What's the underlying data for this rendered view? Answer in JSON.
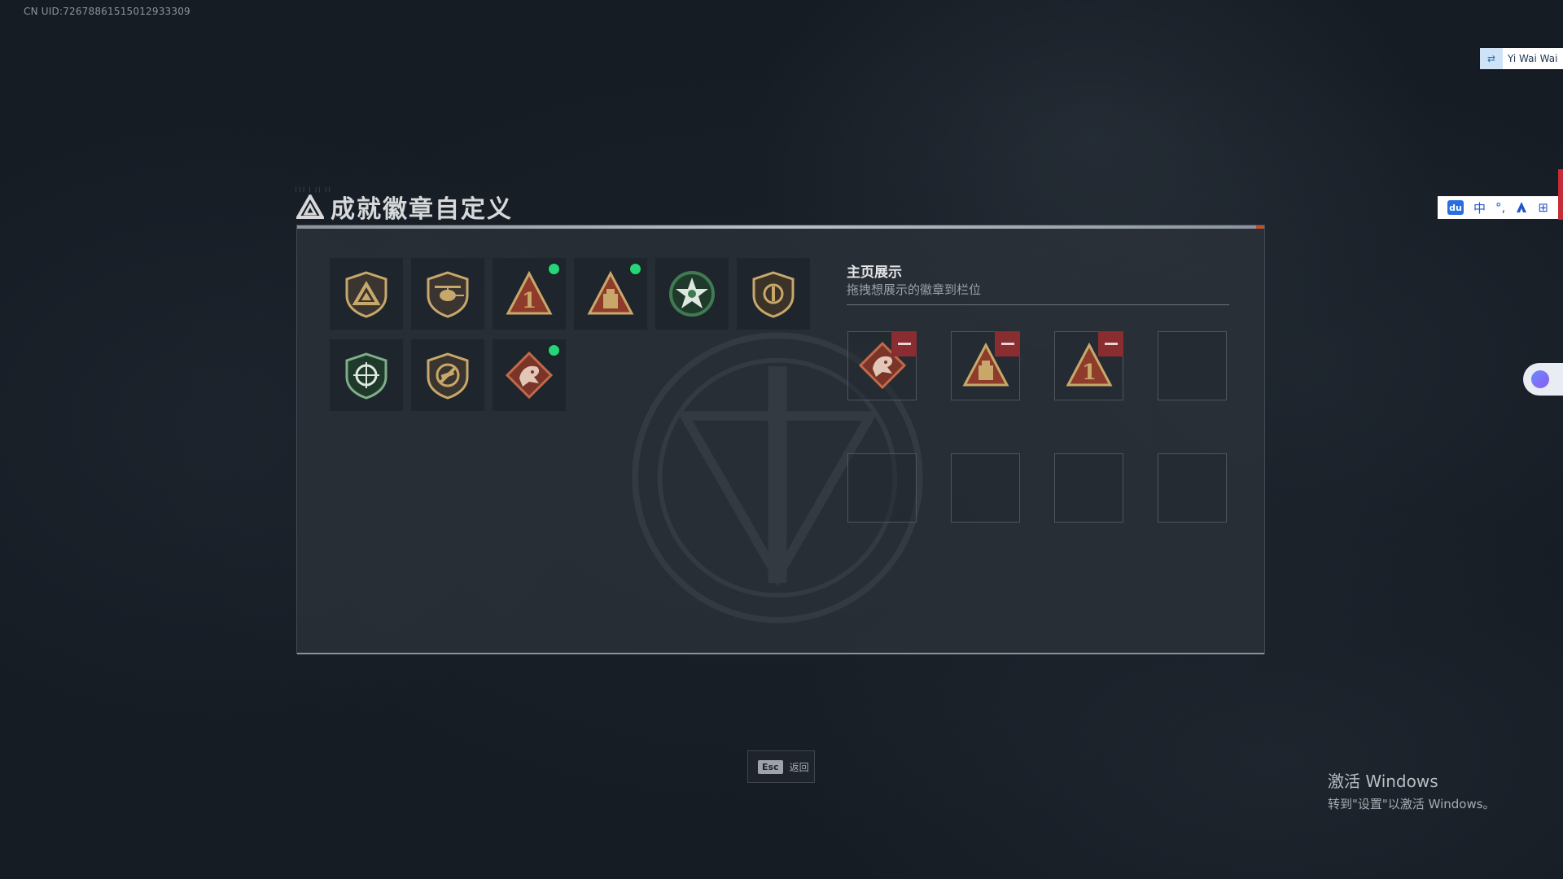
{
  "uid": "CN UID:72678861515012933309",
  "window": {
    "title": "成就徽章自定义"
  },
  "badge_grid": [
    {
      "icon": "triangle-shield-badge-icon",
      "new": false,
      "color": "#c8a86a"
    },
    {
      "icon": "helicopter-shield-badge-icon",
      "new": false,
      "color": "#c8a86a"
    },
    {
      "icon": "rank-one-triangle-badge-icon",
      "new": true,
      "color": "#c8a86a"
    },
    {
      "icon": "supply-crate-triangle-badge-icon",
      "new": true,
      "color": "#c8a86a"
    },
    {
      "icon": "green-star-wreath-badge-icon",
      "new": false,
      "color": "#3f7a52"
    },
    {
      "icon": "gold-emblem-shield-badge-icon",
      "new": false,
      "color": "#c8a86a"
    },
    {
      "icon": "green-crosshair-shield-badge-icon",
      "new": false,
      "color": "#3f7a52"
    },
    {
      "icon": "no-weapon-shield-badge-icon",
      "new": false,
      "color": "#c8a86a"
    },
    {
      "icon": "dragon-diamond-badge-icon",
      "new": true,
      "color": "#b04c3a"
    }
  ],
  "display": {
    "title": "主页展示",
    "subtitle": "拖拽想展示的徽章到栏位",
    "slots": [
      {
        "icon": "dragon-diamond-badge-icon",
        "filled": true
      },
      {
        "icon": "supply-crate-triangle-badge-icon",
        "filled": true
      },
      {
        "icon": "rank-one-triangle-badge-icon",
        "filled": true
      },
      {
        "icon": "",
        "filled": false
      },
      {
        "icon": "",
        "filled": false
      },
      {
        "icon": "",
        "filled": false
      },
      {
        "icon": "",
        "filled": false
      },
      {
        "icon": "",
        "filled": false
      }
    ]
  },
  "footer": {
    "esc_key": "Esc",
    "esc_label": "返回"
  },
  "system": {
    "activate_title": "激活 Windows",
    "activate_hint": "转到\"设置\"以激活 Windows。",
    "ime_user": "Yi Wai Wai",
    "ime_du": "du",
    "ime_lang": "中",
    "ime_punct": "°,",
    "ime_grid": "⊞"
  },
  "colors": {
    "accent_new": "#27d47a",
    "remove_button": "#8a2d31",
    "panel_bg": "#2c323a"
  }
}
